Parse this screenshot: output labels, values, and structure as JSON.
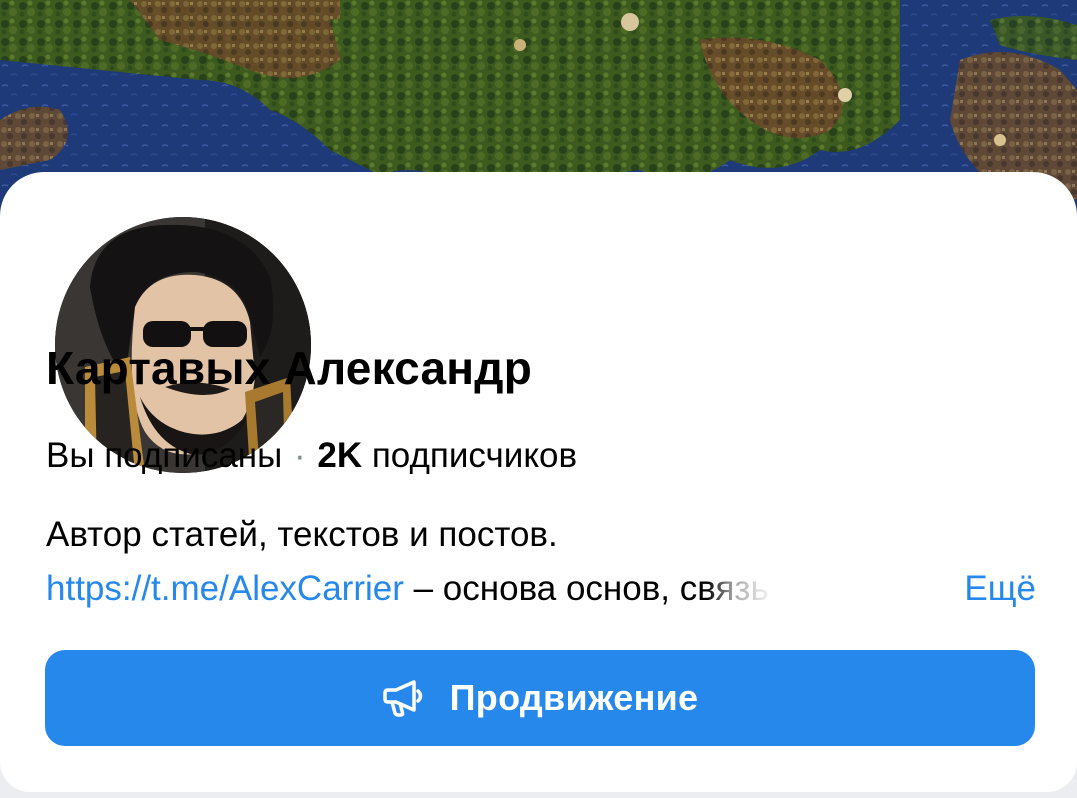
{
  "profile": {
    "name": "Картавых Александр",
    "subscribed_status": "Вы подписаны",
    "separator": "·",
    "subscriber_count": "2K",
    "subscriber_label": "подписчиков",
    "bio_line1": "Автор статей, текстов и постов.",
    "bio_link": "https://t.me/AlexCarrier",
    "bio_line2_rest": " – основа основ, ",
    "bio_line2_fade": "связь",
    "more_label": "Ещё"
  },
  "actions": {
    "promote_label": "Продвижение",
    "promote_icon": "megaphone-icon"
  },
  "colors": {
    "accent": "#2688eb",
    "card": "#ffffff",
    "text": "#000000",
    "separator": "#818c99"
  }
}
